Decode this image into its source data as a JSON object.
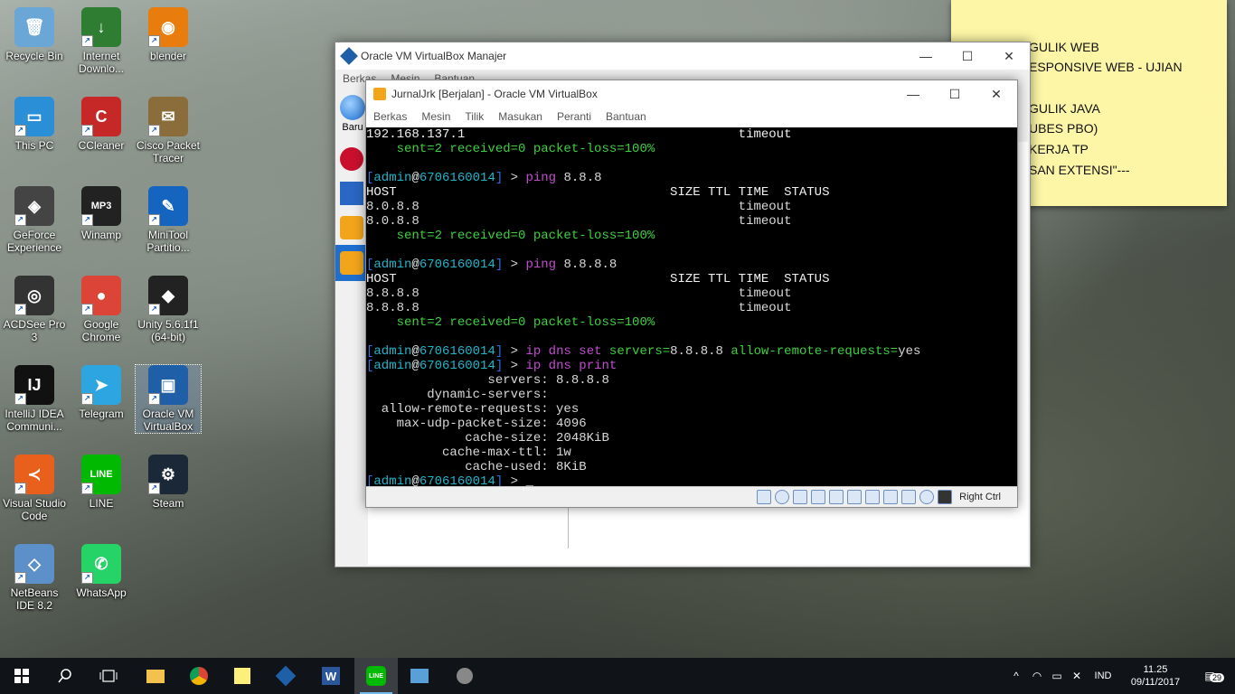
{
  "desktop": {
    "icons": [
      {
        "label": "Recycle Bin",
        "color": "#6aa6d6",
        "glyph": "🗑"
      },
      {
        "label": "Internet Downlo...",
        "color": "#2e7d32",
        "glyph": "↓"
      },
      {
        "label": "blender",
        "color": "#e87d0d",
        "glyph": "◉"
      },
      {
        "label": "This PC",
        "color": "#2b8fd8",
        "glyph": "▭"
      },
      {
        "label": "CCleaner",
        "color": "#c62828",
        "glyph": "C"
      },
      {
        "label": "Cisco Packet Tracer",
        "color": "#8a6d3b",
        "glyph": "✉"
      },
      {
        "label": "GeForce Experience",
        "color": "#444444",
        "glyph": "◈"
      },
      {
        "label": "Winamp",
        "color": "#222222",
        "glyph": "MP3"
      },
      {
        "label": "MiniTool Partitio...",
        "color": "#1565c0",
        "glyph": "✎"
      },
      {
        "label": "ACDSee Pro 3",
        "color": "#333333",
        "glyph": "◎"
      },
      {
        "label": "Google Chrome",
        "color": "#db4437",
        "glyph": "●"
      },
      {
        "label": "Unity 5.6.1f1 (64-bit)",
        "color": "#222222",
        "glyph": "◆"
      },
      {
        "label": "IntelliJ IDEA Communi...",
        "color": "#111111",
        "glyph": "IJ"
      },
      {
        "label": "Telegram",
        "color": "#2ca5e0",
        "glyph": "➤"
      },
      {
        "label": "Oracle VM VirtualBox",
        "color": "#1f5fa8",
        "glyph": "▣"
      },
      {
        "label": "Visual Studio Code",
        "color": "#e8601c",
        "glyph": "≺"
      },
      {
        "label": "LINE",
        "color": "#00b900",
        "glyph": "LINE"
      },
      {
        "label": "Steam",
        "color": "#1b2838",
        "glyph": "⚙"
      },
      {
        "label": "NetBeans IDE 8.2",
        "color": "#5d8fc9",
        "glyph": "◇"
      },
      {
        "label": "WhatsApp",
        "color": "#25d366",
        "glyph": "✆"
      }
    ]
  },
  "sticky": {
    "lines": [
      "GULIK WEB",
      "ESPONSIVE WEB - UJIAN",
      "GULIK JAVA",
      "UBES PBO)",
      "KERJA TP",
      "SAN EXTENSI\"---"
    ]
  },
  "manager": {
    "title": "Oracle VM VirtualBox Manajer",
    "menu": [
      "Berkas",
      "Mesin",
      "Bantuan"
    ],
    "new_label": "Baru"
  },
  "vm": {
    "title": "JurnalJrk [Berjalan] - Oracle VM VirtualBox",
    "menu": [
      "Berkas",
      "Mesin",
      "Tilik",
      "Masukan",
      "Peranti",
      "Bantuan"
    ],
    "host_key": "Right Ctrl"
  },
  "terminal": {
    "l01": "192.168.137.1                                    timeout",
    "l02": "    sent=2 received=0 packet-loss=100%",
    "p1_user": "admin",
    "p1_host": "6706160014",
    "p1_cmd": "ping",
    "p1_arg": "8.8.8",
    "header": "HOST                                    SIZE TTL TIME  STATUS",
    "r1": "8.0.8.8                                          timeout",
    "r2": "8.0.8.8                                          timeout",
    "l_sent2": "    sent=2 received=0 packet-loss=100%",
    "p2_user": "admin",
    "p2_host": "6706160014",
    "p2_cmd": "ping",
    "p2_arg": "8.8.8.8",
    "r3": "8.8.8.8                                          timeout",
    "r4": "8.8.8.8                                          timeout",
    "l_sent3": "    sent=2 received=0 packet-loss=100%",
    "p3_user": "admin",
    "p3_host": "6706160014",
    "p3_cmd1": "ip dns",
    "p3_cmd2": "set",
    "p3_key1": "servers=",
    "p3_val1": "8.8.8.8",
    "p3_key2": "allow-remote-requests=",
    "p3_val2": "yes",
    "p4_user": "admin",
    "p4_host": "6706160014",
    "p4_cmd1": "ip dns",
    "p4_cmd2": "print",
    "o1": "                servers: 8.8.8.8",
    "o2": "        dynamic-servers: ",
    "o3": "  allow-remote-requests: yes",
    "o4": "    max-udp-packet-size: 4096",
    "o5": "             cache-size: 2048KiB",
    "o6": "          cache-max-ttl: 1w",
    "o7": "             cache-used: 8KiB",
    "p5_user": "admin",
    "p5_host": "6706160014",
    "cursor": "_"
  },
  "taskbar": {
    "lang": "IND",
    "time": "11.25",
    "date": "09/11/2017",
    "notifications": "29"
  }
}
